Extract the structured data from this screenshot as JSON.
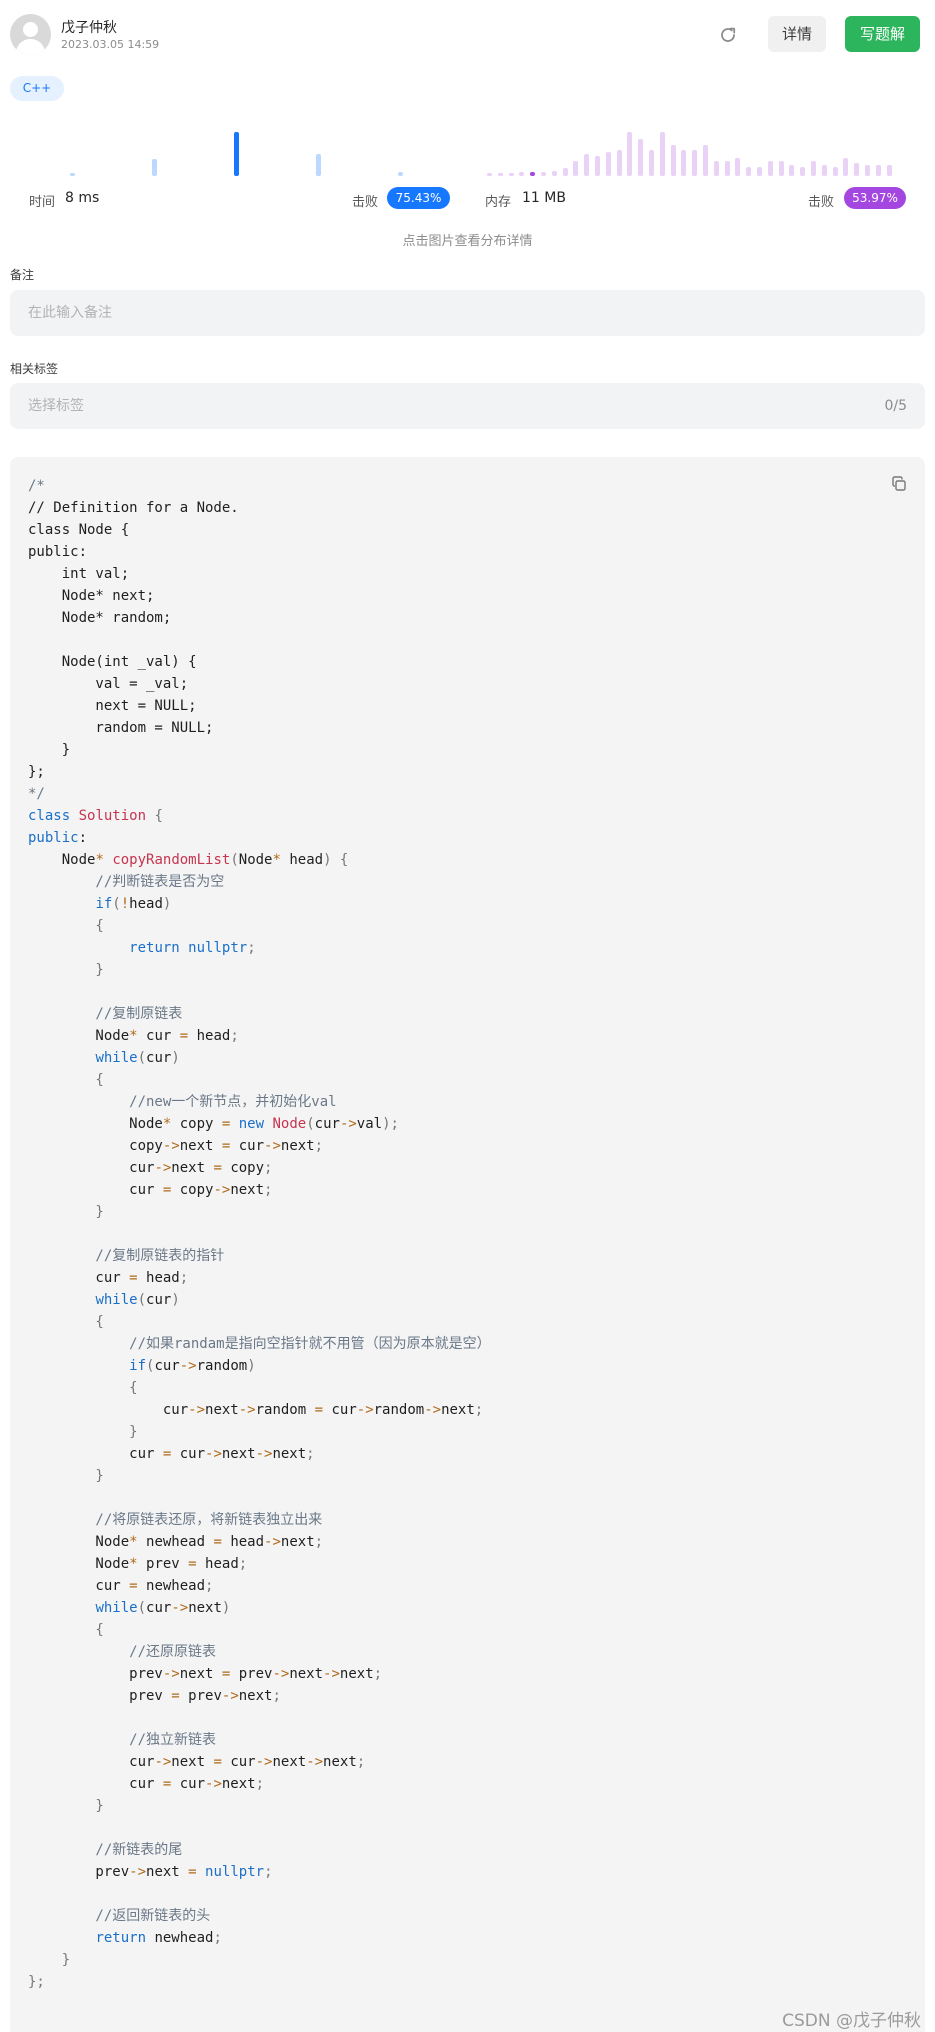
{
  "header": {
    "author": "戊子仲秋",
    "date": "2023.03.05 14:59",
    "details_label": "详情",
    "write_label": "写题解"
  },
  "tag": {
    "label": "C++"
  },
  "runtime": {
    "label": "时间",
    "value": "8 ms",
    "beat_label": "击败",
    "beat_percent": "75.43%",
    "color": "#1677ff",
    "histogram": [
      0.05,
      0.38,
      1.0,
      0.5,
      0.08
    ]
  },
  "memory": {
    "label": "内存",
    "value": "11 MB",
    "beat_label": "击败",
    "beat_percent": "53.97%",
    "color": "#a347e0",
    "histogram": [
      0.06,
      0.06,
      0.06,
      0.08,
      0.1,
      0.1,
      0.12,
      0.18,
      0.35,
      0.5,
      0.45,
      0.55,
      0.6,
      1.0,
      0.85,
      0.6,
      1.0,
      0.7,
      0.6,
      0.6,
      0.7,
      0.35,
      0.35,
      0.4,
      0.2,
      0.2,
      0.35,
      0.35,
      0.25,
      0.2,
      0.35,
      0.25,
      0.2,
      0.4,
      0.3,
      0.25,
      0.25,
      0.25
    ],
    "highlight_index": 4
  },
  "hint": "点击图片查看分布详情",
  "note": {
    "label": "备注",
    "placeholder": "在此输入备注"
  },
  "tags_field": {
    "label": "相关标签",
    "placeholder": "选择标签",
    "count": "0/5"
  },
  "code_lines": [
    [
      [
        "cm",
        "/*"
      ]
    ],
    [
      [
        "tx",
        "// Definition for a Node."
      ]
    ],
    [
      [
        "tx",
        "class Node {"
      ]
    ],
    [
      [
        "tx",
        "public:"
      ]
    ],
    [
      [
        "tx",
        "    int val;"
      ]
    ],
    [
      [
        "tx",
        "    Node* next;"
      ]
    ],
    [
      [
        "tx",
        "    Node* random;"
      ]
    ],
    [
      [
        "tx",
        ""
      ]
    ],
    [
      [
        "tx",
        "    Node(int _val) {"
      ]
    ],
    [
      [
        "tx",
        "        val = _val;"
      ]
    ],
    [
      [
        "tx",
        "        next = NULL;"
      ]
    ],
    [
      [
        "tx",
        "        random = NULL;"
      ]
    ],
    [
      [
        "tx",
        "    }"
      ]
    ],
    [
      [
        "tx",
        "};"
      ]
    ],
    [
      [
        "cm",
        "*/"
      ]
    ],
    [
      [
        "kw",
        "class"
      ],
      [
        "tx",
        " "
      ],
      [
        "ty",
        "Solution"
      ],
      [
        "pn",
        " {"
      ]
    ],
    [
      [
        "kw",
        "public"
      ],
      [
        "tx",
        ":"
      ]
    ],
    [
      [
        "tx",
        "    Node"
      ],
      [
        "op",
        "*"
      ],
      [
        "tx",
        " "
      ],
      [
        "ty",
        "copyRandomList"
      ],
      [
        "pn",
        "("
      ],
      [
        "tx",
        "Node"
      ],
      [
        "op",
        "*"
      ],
      [
        "tx",
        " head"
      ],
      [
        "pn",
        ") {"
      ]
    ],
    [
      [
        "cm",
        "        //判断链表是否为空"
      ]
    ],
    [
      [
        "tx",
        "        "
      ],
      [
        "kw",
        "if"
      ],
      [
        "pn",
        "("
      ],
      [
        "op",
        "!"
      ],
      [
        "tx",
        "head"
      ],
      [
        "pn",
        ")"
      ]
    ],
    [
      [
        "pn",
        "        {"
      ]
    ],
    [
      [
        "tx",
        "            "
      ],
      [
        "kw",
        "return"
      ],
      [
        "tx",
        " "
      ],
      [
        "kw",
        "nullptr"
      ],
      [
        "pn",
        ";"
      ]
    ],
    [
      [
        "pn",
        "        }"
      ]
    ],
    [
      [
        "tx",
        ""
      ]
    ],
    [
      [
        "cm",
        "        //复制原链表"
      ]
    ],
    [
      [
        "tx",
        "        Node"
      ],
      [
        "op",
        "*"
      ],
      [
        "tx",
        " cur "
      ],
      [
        "op",
        "="
      ],
      [
        "tx",
        " head"
      ],
      [
        "pn",
        ";"
      ]
    ],
    [
      [
        "tx",
        "        "
      ],
      [
        "kw",
        "while"
      ],
      [
        "pn",
        "("
      ],
      [
        "tx",
        "cur"
      ],
      [
        "pn",
        ")"
      ]
    ],
    [
      [
        "pn",
        "        {"
      ]
    ],
    [
      [
        "cm",
        "            //new一个新节点，并初始化val"
      ]
    ],
    [
      [
        "tx",
        "            Node"
      ],
      [
        "op",
        "*"
      ],
      [
        "tx",
        " copy "
      ],
      [
        "op",
        "="
      ],
      [
        "tx",
        " "
      ],
      [
        "kw",
        "new"
      ],
      [
        "tx",
        " "
      ],
      [
        "ty",
        "Node"
      ],
      [
        "pn",
        "("
      ],
      [
        "tx",
        "cur"
      ],
      [
        "op",
        "->"
      ],
      [
        "tx",
        "val"
      ],
      [
        "pn",
        ");"
      ]
    ],
    [
      [
        "tx",
        "            copy"
      ],
      [
        "op",
        "->"
      ],
      [
        "tx",
        "next "
      ],
      [
        "op",
        "="
      ],
      [
        "tx",
        " cur"
      ],
      [
        "op",
        "->"
      ],
      [
        "tx",
        "next"
      ],
      [
        "pn",
        ";"
      ]
    ],
    [
      [
        "tx",
        "            cur"
      ],
      [
        "op",
        "->"
      ],
      [
        "tx",
        "next "
      ],
      [
        "op",
        "="
      ],
      [
        "tx",
        " copy"
      ],
      [
        "pn",
        ";"
      ]
    ],
    [
      [
        "tx",
        "            cur "
      ],
      [
        "op",
        "="
      ],
      [
        "tx",
        " copy"
      ],
      [
        "op",
        "->"
      ],
      [
        "tx",
        "next"
      ],
      [
        "pn",
        ";"
      ]
    ],
    [
      [
        "pn",
        "        }"
      ]
    ],
    [
      [
        "tx",
        ""
      ]
    ],
    [
      [
        "cm",
        "        //复制原链表的指针"
      ]
    ],
    [
      [
        "tx",
        "        cur "
      ],
      [
        "op",
        "="
      ],
      [
        "tx",
        " head"
      ],
      [
        "pn",
        ";"
      ]
    ],
    [
      [
        "tx",
        "        "
      ],
      [
        "kw",
        "while"
      ],
      [
        "pn",
        "("
      ],
      [
        "tx",
        "cur"
      ],
      [
        "pn",
        ")"
      ]
    ],
    [
      [
        "pn",
        "        {"
      ]
    ],
    [
      [
        "cm",
        "            //如果randam是指向空指针就不用管（因为原本就是空）"
      ]
    ],
    [
      [
        "tx",
        "            "
      ],
      [
        "kw",
        "if"
      ],
      [
        "pn",
        "("
      ],
      [
        "tx",
        "cur"
      ],
      [
        "op",
        "->"
      ],
      [
        "tx",
        "random"
      ],
      [
        "pn",
        ")"
      ]
    ],
    [
      [
        "pn",
        "            {"
      ]
    ],
    [
      [
        "tx",
        "                cur"
      ],
      [
        "op",
        "->"
      ],
      [
        "tx",
        "next"
      ],
      [
        "op",
        "->"
      ],
      [
        "tx",
        "random "
      ],
      [
        "op",
        "="
      ],
      [
        "tx",
        " cur"
      ],
      [
        "op",
        "->"
      ],
      [
        "tx",
        "random"
      ],
      [
        "op",
        "->"
      ],
      [
        "tx",
        "next"
      ],
      [
        "pn",
        ";"
      ]
    ],
    [
      [
        "pn",
        "            }"
      ]
    ],
    [
      [
        "tx",
        "            cur "
      ],
      [
        "op",
        "="
      ],
      [
        "tx",
        " cur"
      ],
      [
        "op",
        "->"
      ],
      [
        "tx",
        "next"
      ],
      [
        "op",
        "->"
      ],
      [
        "tx",
        "next"
      ],
      [
        "pn",
        ";"
      ]
    ],
    [
      [
        "pn",
        "        }"
      ]
    ],
    [
      [
        "tx",
        ""
      ]
    ],
    [
      [
        "cm",
        "        //将原链表还原，将新链表独立出来"
      ]
    ],
    [
      [
        "tx",
        "        Node"
      ],
      [
        "op",
        "*"
      ],
      [
        "tx",
        " newhead "
      ],
      [
        "op",
        "="
      ],
      [
        "tx",
        " head"
      ],
      [
        "op",
        "->"
      ],
      [
        "tx",
        "next"
      ],
      [
        "pn",
        ";"
      ]
    ],
    [
      [
        "tx",
        "        Node"
      ],
      [
        "op",
        "*"
      ],
      [
        "tx",
        " prev "
      ],
      [
        "op",
        "="
      ],
      [
        "tx",
        " head"
      ],
      [
        "pn",
        ";"
      ]
    ],
    [
      [
        "tx",
        "        cur "
      ],
      [
        "op",
        "="
      ],
      [
        "tx",
        " newhead"
      ],
      [
        "pn",
        ";"
      ]
    ],
    [
      [
        "tx",
        "        "
      ],
      [
        "kw",
        "while"
      ],
      [
        "pn",
        "("
      ],
      [
        "tx",
        "cur"
      ],
      [
        "op",
        "->"
      ],
      [
        "tx",
        "next"
      ],
      [
        "pn",
        ")"
      ]
    ],
    [
      [
        "pn",
        "        {"
      ]
    ],
    [
      [
        "cm",
        "            //还原原链表"
      ]
    ],
    [
      [
        "tx",
        "            prev"
      ],
      [
        "op",
        "->"
      ],
      [
        "tx",
        "next "
      ],
      [
        "op",
        "="
      ],
      [
        "tx",
        " prev"
      ],
      [
        "op",
        "->"
      ],
      [
        "tx",
        "next"
      ],
      [
        "op",
        "->"
      ],
      [
        "tx",
        "next"
      ],
      [
        "pn",
        ";"
      ]
    ],
    [
      [
        "tx",
        "            prev "
      ],
      [
        "op",
        "="
      ],
      [
        "tx",
        " prev"
      ],
      [
        "op",
        "->"
      ],
      [
        "tx",
        "next"
      ],
      [
        "pn",
        ";"
      ]
    ],
    [
      [
        "tx",
        ""
      ]
    ],
    [
      [
        "cm",
        "            //独立新链表"
      ]
    ],
    [
      [
        "tx",
        "            cur"
      ],
      [
        "op",
        "->"
      ],
      [
        "tx",
        "next "
      ],
      [
        "op",
        "="
      ],
      [
        "tx",
        " cur"
      ],
      [
        "op",
        "->"
      ],
      [
        "tx",
        "next"
      ],
      [
        "op",
        "->"
      ],
      [
        "tx",
        "next"
      ],
      [
        "pn",
        ";"
      ]
    ],
    [
      [
        "tx",
        "            cur "
      ],
      [
        "op",
        "="
      ],
      [
        "tx",
        " cur"
      ],
      [
        "op",
        "->"
      ],
      [
        "tx",
        "next"
      ],
      [
        "pn",
        ";"
      ]
    ],
    [
      [
        "pn",
        "        }"
      ]
    ],
    [
      [
        "tx",
        ""
      ]
    ],
    [
      [
        "cm",
        "        //新链表的尾"
      ]
    ],
    [
      [
        "tx",
        "        prev"
      ],
      [
        "op",
        "->"
      ],
      [
        "tx",
        "next "
      ],
      [
        "op",
        "="
      ],
      [
        "tx",
        " "
      ],
      [
        "kw",
        "nullptr"
      ],
      [
        "pn",
        ";"
      ]
    ],
    [
      [
        "tx",
        ""
      ]
    ],
    [
      [
        "cm",
        "        //返回新链表的头"
      ]
    ],
    [
      [
        "tx",
        "        "
      ],
      [
        "kw",
        "return"
      ],
      [
        "tx",
        " newhead"
      ],
      [
        "pn",
        ";"
      ]
    ],
    [
      [
        "pn",
        "    }"
      ]
    ],
    [
      [
        "pn",
        "};"
      ]
    ]
  ],
  "watermark": "CSDN @戊子仲秋"
}
